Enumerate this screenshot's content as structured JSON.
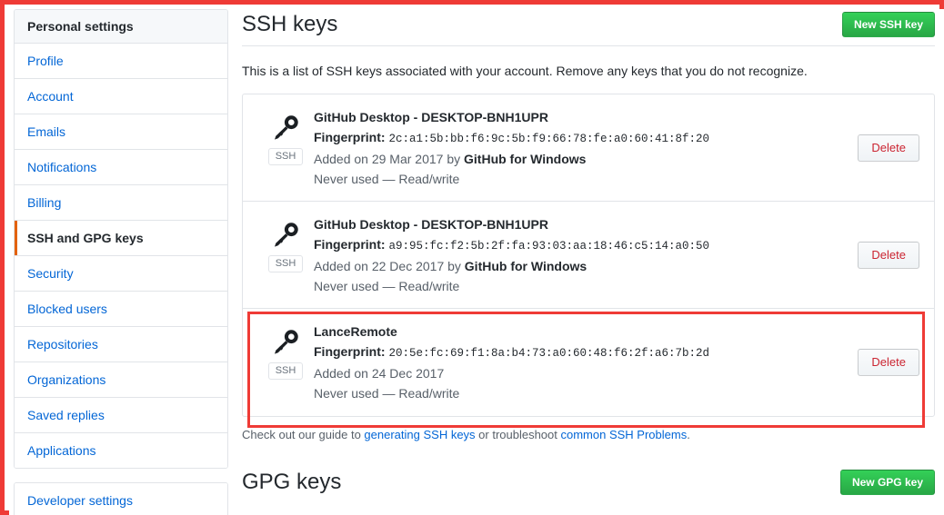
{
  "sidebar": {
    "header": "Personal settings",
    "items": [
      {
        "label": "Profile",
        "selected": false
      },
      {
        "label": "Account",
        "selected": false
      },
      {
        "label": "Emails",
        "selected": false
      },
      {
        "label": "Notifications",
        "selected": false
      },
      {
        "label": "Billing",
        "selected": false
      },
      {
        "label": "SSH and GPG keys",
        "selected": true
      },
      {
        "label": "Security",
        "selected": false
      },
      {
        "label": "Blocked users",
        "selected": false
      },
      {
        "label": "Repositories",
        "selected": false
      },
      {
        "label": "Organizations",
        "selected": false
      },
      {
        "label": "Saved replies",
        "selected": false
      },
      {
        "label": "Applications",
        "selected": false
      }
    ],
    "developer_settings": "Developer settings"
  },
  "ssh_section": {
    "title": "SSH keys",
    "new_key_button": "New SSH key",
    "description": "This is a list of SSH keys associated with your account. Remove any keys that you do not recognize.",
    "keys": [
      {
        "badge": "SSH",
        "title": "GitHub Desktop - DESKTOP-BNH1UPR",
        "fingerprint_label": "Fingerprint:",
        "fingerprint": "2c:a1:5b:bb:f6:9c:5b:f9:66:78:fe:a0:60:41:8f:20",
        "added_prefix": "Added on 29 Mar 2017 by ",
        "added_by": "GitHub for Windows",
        "usage": "Never used — Read/write",
        "delete_label": "Delete",
        "highlighted": false
      },
      {
        "badge": "SSH",
        "title": "GitHub Desktop - DESKTOP-BNH1UPR",
        "fingerprint_label": "Fingerprint:",
        "fingerprint": "a9:95:fc:f2:5b:2f:fa:93:03:aa:18:46:c5:14:a0:50",
        "added_prefix": "Added on 22 Dec 2017 by ",
        "added_by": "GitHub for Windows",
        "usage": "Never used — Read/write",
        "delete_label": "Delete",
        "highlighted": false
      },
      {
        "badge": "SSH",
        "title": "LanceRemote",
        "fingerprint_label": "Fingerprint:",
        "fingerprint": "20:5e:fc:69:f1:8a:b4:73:a0:60:48:f6:2f:a6:7b:2d",
        "added_prefix": "Added on 24 Dec 2017",
        "added_by": "",
        "usage": "Never used — Read/write",
        "delete_label": "Delete",
        "highlighted": true
      }
    ],
    "footer": {
      "text_before": "Check out our guide to ",
      "link1": "generating SSH keys",
      "text_middle": " or troubleshoot ",
      "link2": "common SSH Problems",
      "text_after": "."
    }
  },
  "gpg_section": {
    "title": "GPG keys",
    "new_key_button": "New GPG key"
  },
  "colors": {
    "accent_green": "#28a745",
    "link_blue": "#0366d6",
    "danger_red": "#cb2431",
    "annotation_red": "#ef3b36",
    "selected_orange": "#e36209",
    "border_gray": "#e1e4e8",
    "muted_text": "#586069"
  },
  "icons": {
    "key": "key-icon"
  }
}
